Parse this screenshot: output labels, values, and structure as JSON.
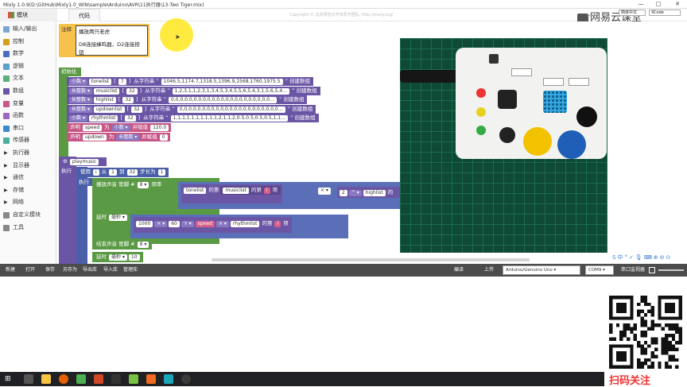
{
  "window": {
    "title": "Mixly 1.0.9(D:\\GitHub\\Mixly1.0_WIN\\sample\\Arduino\\AVR\\11执行器\\13-Two Tiger.mix)",
    "controls": [
      "—",
      "□",
      "✕"
    ]
  },
  "tabs": {
    "modules": "模块",
    "code": "代码"
  },
  "header": {
    "copyright": "Copyright © 北京师范大学米思齐团队, http://mixly.org/",
    "brand": "网易云课堂",
    "lang": "简体中文",
    "xcode": "XCode"
  },
  "sidebar": {
    "items": [
      {
        "label": "输入/输出",
        "color": "#7aa6d6",
        "expandable": false
      },
      {
        "label": "控制",
        "color": "#d4a020",
        "expandable": false
      },
      {
        "label": "数学",
        "color": "#4a6fc2",
        "expandable": false
      },
      {
        "label": "逻辑",
        "color": "#5aa0c8",
        "expandable": false
      },
      {
        "label": "文本",
        "color": "#5ab07a",
        "expandable": false
      },
      {
        "label": "数组",
        "color": "#6b56a6",
        "expandable": false
      },
      {
        "label": "变量",
        "color": "#c85a8a",
        "expandable": false
      },
      {
        "label": "函数",
        "color": "#9a6ac0",
        "expandable": false
      },
      {
        "label": "串口",
        "color": "#3a8acd",
        "expandable": false
      },
      {
        "label": "传感器",
        "color": "#4ab0a0",
        "expandable": false
      },
      {
        "label": "执行器",
        "color": "",
        "expandable": true
      },
      {
        "label": "显示器",
        "color": "",
        "expandable": true
      },
      {
        "label": "通信",
        "color": "",
        "expandable": true
      },
      {
        "label": "存储",
        "color": "",
        "expandable": true
      },
      {
        "label": "网络",
        "color": "",
        "expandable": true
      },
      {
        "label": "自定义模块",
        "color": "#888888",
        "expandable": false
      },
      {
        "label": "工具",
        "color": "#888888",
        "expandable": false
      }
    ]
  },
  "comment": {
    "label": "注释",
    "line1": "播放两只老虎",
    "line2": "D8连接蜂鸣器，D2连接按钮"
  },
  "blocks": {
    "init": "初始化",
    "arrays": [
      {
        "type": "小数",
        "name": "tonelist",
        "size": "7",
        "from": "从字符串",
        "value": "1046.5,1174.7,1318.5,1396.9,1568,1760,1975.5",
        "action": "创建数组"
      },
      {
        "type": "长整数",
        "name": "musiclist",
        "size": "32",
        "from": "从字符串",
        "value": "1,2,3,1,1,2,3,1,3,4,5,3,4,5,5,6,5,4,3,1,5,6,5,4…",
        "action": "创建数组"
      },
      {
        "type": "长整数",
        "name": "highlist",
        "size": "32",
        "from": "从字符串",
        "value": "0,0,0,0,0,0,0,0,0,0,0,0,0,0,0,0,0,0,0,0,0,0…",
        "action": "创建数组"
      },
      {
        "type": "长整数",
        "name": "updownlist",
        "size": "32",
        "from": "从字符串",
        "value": "0,0,0,0,0,0,0,0,0,0,0,0,0,0,0,0,0,0,0,0,0,0…",
        "action": "创建数组"
      },
      {
        "type": "小数",
        "name": "rhythmlist",
        "size": "32",
        "from": "从字符串",
        "value": "1,1,1,1,1,1,1,1,1,1,2,1,1,2,0.5,0.5,0.5,0.5,1,1…",
        "action": "创建数组"
      }
    ],
    "declares": [
      {
        "kw": "声明",
        "name": "speed",
        "as": "为",
        "type": "小数",
        "assign": "并赋值",
        "value": "120.0"
      },
      {
        "kw": "声明",
        "name": "updown",
        "as": "为",
        "type": "长整数",
        "assign": "并赋值",
        "value": "0"
      }
    ],
    "func": {
      "name": "playmusic",
      "exec": "执行",
      "loop": {
        "use": "使用",
        "var": "i",
        "from": "从",
        "start": "1",
        "to": "到",
        "end": "32",
        "step": "步长为",
        "stepval": "1"
      },
      "play": {
        "label": "播放声音 管脚 #",
        "pin": "8",
        "freq": "频率",
        "arr1": "tonelist",
        "of": "的第",
        "arr2": "musiclist",
        "idx": "i",
        "item": "项",
        "op": "×",
        "two": "2",
        "arr3": "highlist"
      },
      "delay1": {
        "label": "延时",
        "unit": "毫秒",
        "n1": "1000",
        "op1": "×",
        "n2": "60",
        "op2": "÷",
        "var": "speed",
        "op3": "×",
        "arr": "rhythmlist",
        "of": "的第",
        "idx": "i",
        "item": "项"
      },
      "stop": {
        "label": "结束声音 管脚 #",
        "pin": "8"
      },
      "delay2": {
        "label": "延时",
        "unit": "毫秒",
        "value": "10"
      }
    }
  },
  "toolbar": {
    "buttons": [
      "新建",
      "打开",
      "保存",
      "另存为",
      "导出库",
      "导入库",
      "管理库"
    ],
    "compile": "编译",
    "upload": "上传",
    "board": "Arduino/Genuino Uno",
    "port": "COM9",
    "serial": "串口监视器"
  },
  "qr_label": "扫码关注",
  "colors": {
    "toolbar": "#4c4c4c",
    "block_purple": "#6b56a6",
    "block_green": "#5b9a44",
    "block_blue": "#4a5fa8",
    "taskbar": "#202124"
  }
}
